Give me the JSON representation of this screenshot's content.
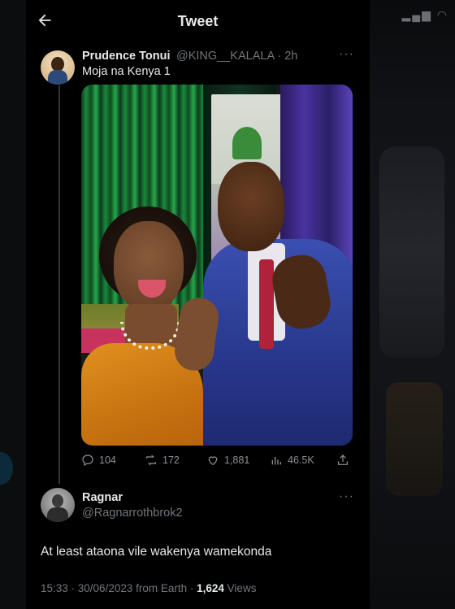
{
  "header": {
    "title": "Tweet",
    "back_icon": "arrow-left-icon"
  },
  "tweet": {
    "author_name": "Prudence Tonui",
    "author_meta": "@KING__KALALA · 2h",
    "text": "Moja na Kenya 1",
    "stats": {
      "replies": "104",
      "retweets": "172",
      "likes": "1,881",
      "views": "46.5K"
    }
  },
  "reply": {
    "author_name": "Ragnar",
    "author_handle": "@Ragnarrothbrok2",
    "text": "At least ataona vile wakenya wamekonda",
    "timestamp": "15:33 · 30/06/2023 from Earth · ",
    "views_count": "1,624",
    "views_label": " Views"
  },
  "more_label": "···",
  "background_status": "▂▄▆ ◠"
}
